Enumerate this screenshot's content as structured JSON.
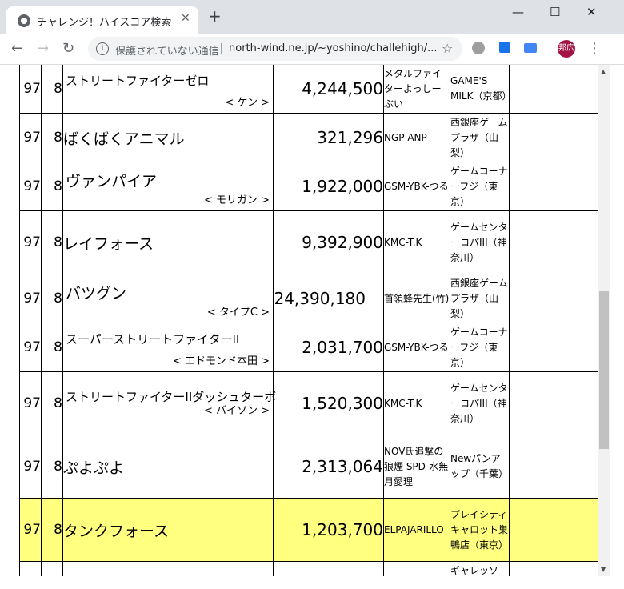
{
  "tab": {
    "title": "チャレンジ！ハイスコア検索",
    "close": "✕",
    "new_tab": "+"
  },
  "window": {
    "minimize": "—",
    "maximize": "☐",
    "close": "✕"
  },
  "toolbar": {
    "back": "←",
    "forward": "→",
    "reload": "↻",
    "info": "i",
    "not_secure": "保護されていない通信",
    "url": "north-wind.ne.jp/~yoshino/challehigh/...",
    "star": "☆",
    "avatar": "邦広",
    "menu": "⋮"
  },
  "scrollbar": {
    "up": "▲",
    "down": "▼"
  },
  "rows": [
    {
      "rank": "97",
      "num": "8",
      "game": "ストリートファイターゼロ",
      "sub": "< ケン >",
      "score": "4,244,500",
      "player": "メタルファイターよっしーぶい",
      "shop": "GAME'S MILK（京都）"
    },
    {
      "rank": "97",
      "num": "8",
      "game": "ばくばくアニマル",
      "sub": "",
      "score": "321,296",
      "player": "NGP-ANP",
      "shop": "西銀座ゲームプラザ（山梨）"
    },
    {
      "rank": "97",
      "num": "8",
      "game": "ヴァンパイア",
      "sub": "< モリガン >",
      "score": "1,922,000",
      "player": "GSM-YBK-つる",
      "shop": "ゲームコーナーフジ（東京）"
    },
    {
      "rank": "97",
      "num": "8",
      "game": "レイフォース",
      "sub": "",
      "score": "9,392,900",
      "player": "KMC-T.K",
      "shop": "ゲームセンターコパIII（神奈川）"
    },
    {
      "rank": "97",
      "num": "8",
      "game": "バツグン",
      "sub": "< タイプC >",
      "score": "24,390,180",
      "player": "首領蜂先生(竹)",
      "shop": "西銀座ゲームプラザ（山梨）"
    },
    {
      "rank": "97",
      "num": "8",
      "game": "スーパーストリートファイターII",
      "sub": "< エドモンド本田 >",
      "score": "2,031,700",
      "player": "GSM-YBK-つる",
      "shop": "ゲームコーナーフジ（東京）"
    },
    {
      "rank": "97",
      "num": "8",
      "game": "ストリートファイターIIダッシュターボ",
      "sub": "< バイソン >",
      "score": "1,520,300",
      "player": "KMC-T.K",
      "shop": "ゲームセンターコパIII（神奈川）"
    },
    {
      "rank": "97",
      "num": "8",
      "game": "ぷよぷよ",
      "sub": "",
      "score": "2,313,064",
      "player": "NOV氏追撃の狼煙 SPD-水無月愛理",
      "shop": "Newパンアップ（千葉）"
    },
    {
      "rank": "97",
      "num": "8",
      "game": "タンクフォース",
      "sub": "",
      "score": "1,203,700",
      "player": "ELPAJARILLO",
      "shop": "プレイシティキャロット巣鴨店（東京）"
    },
    {
      "rank": "",
      "num": "",
      "game": "",
      "sub": "",
      "score": "",
      "player": "",
      "shop": "ギャレッソ"
    }
  ],
  "colors": {
    "highlight": "#ffff80",
    "titlebar": "#dee1e6"
  }
}
